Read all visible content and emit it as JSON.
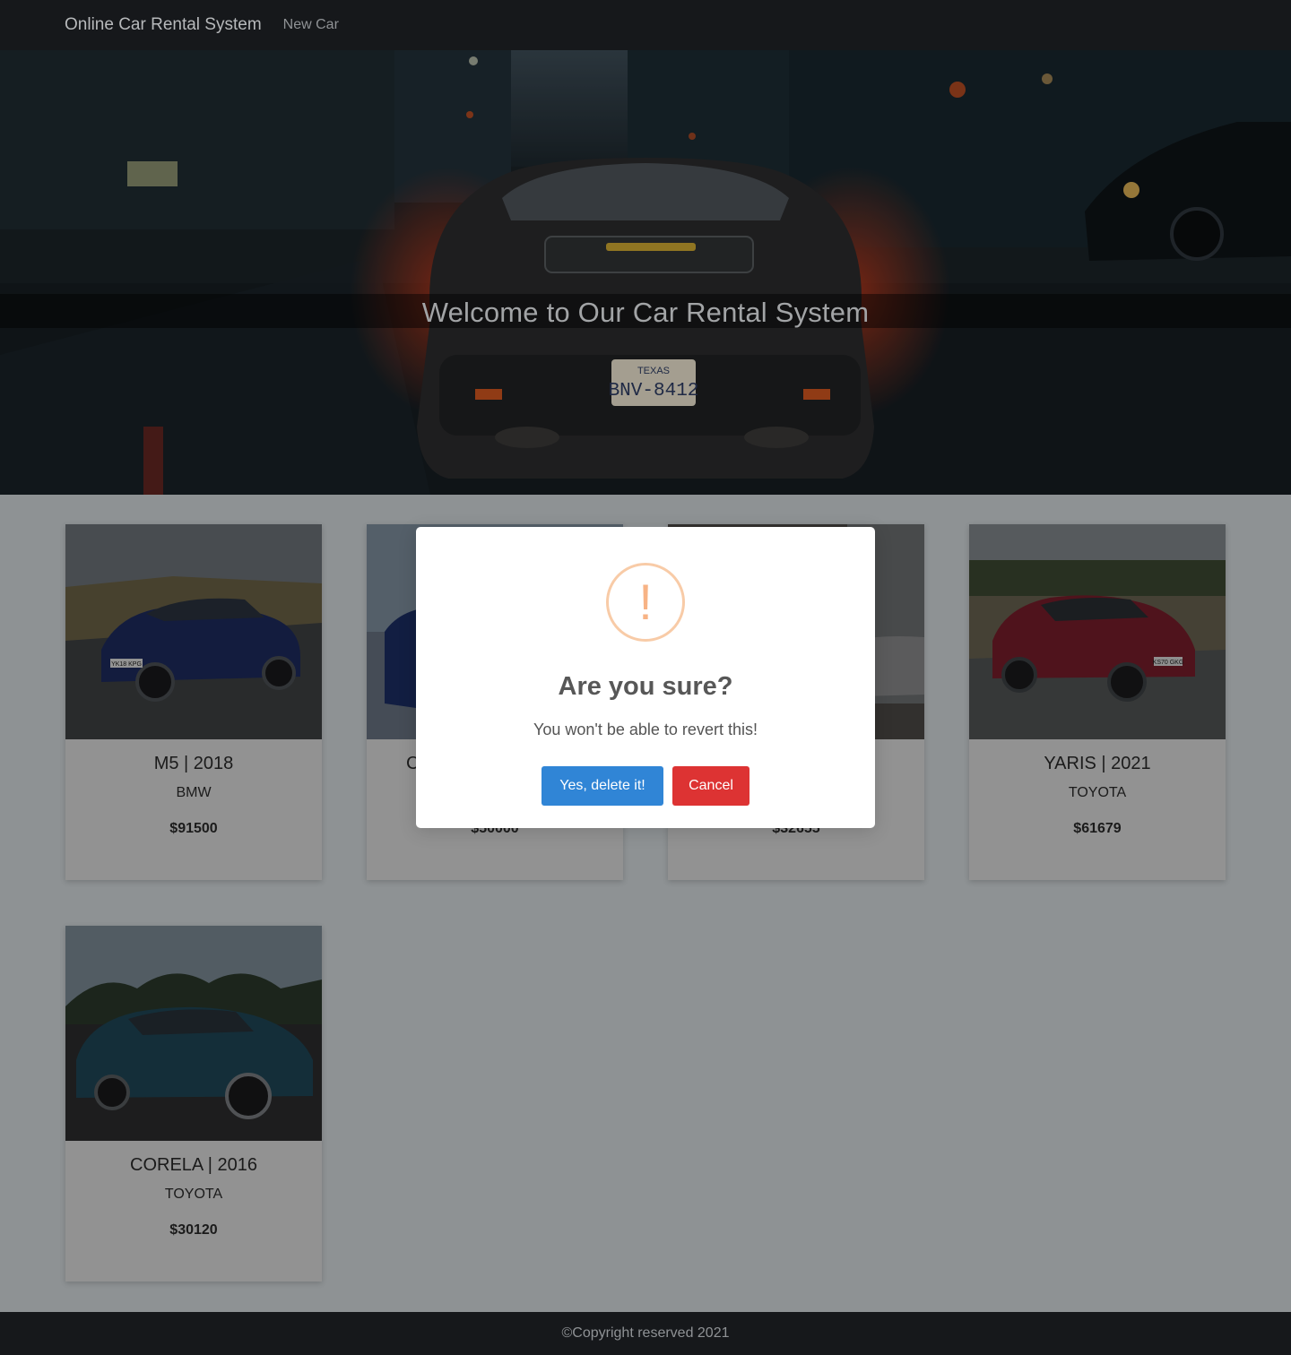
{
  "navbar": {
    "brand": "Online Car Rental System",
    "new_car": "New Car"
  },
  "hero": {
    "title": "Welcome to Our Car Rental System",
    "plate_state": "TEXAS",
    "plate_number": "BNV-8412"
  },
  "cars": [
    {
      "model_year": "M5 | 2018",
      "brand": "BMW",
      "price": "$91500",
      "plate": "YK18 KPG"
    },
    {
      "model_year": "C",
      "brand": "",
      "price": "$50000"
    },
    {
      "model_year": "",
      "brand": "",
      "price": "$32655"
    },
    {
      "model_year": "YARIS | 2021",
      "brand": "TOYOTA",
      "price": "$61679",
      "plate": "KS70 GKG"
    },
    {
      "model_year": "CORELA | 2016",
      "brand": "TOYOTA",
      "price": "$30120"
    }
  ],
  "modal": {
    "icon": "!",
    "title": "Are you sure?",
    "text": "You won't be able to revert this!",
    "confirm_label": "Yes, delete it!",
    "cancel_label": "Cancel"
  },
  "footer": {
    "text": "©Copyright reserved 2021"
  },
  "colors": {
    "navbar": "#16181b",
    "confirm": "#3085d6",
    "cancel": "#dd3333",
    "warning": "#f8bb86"
  }
}
